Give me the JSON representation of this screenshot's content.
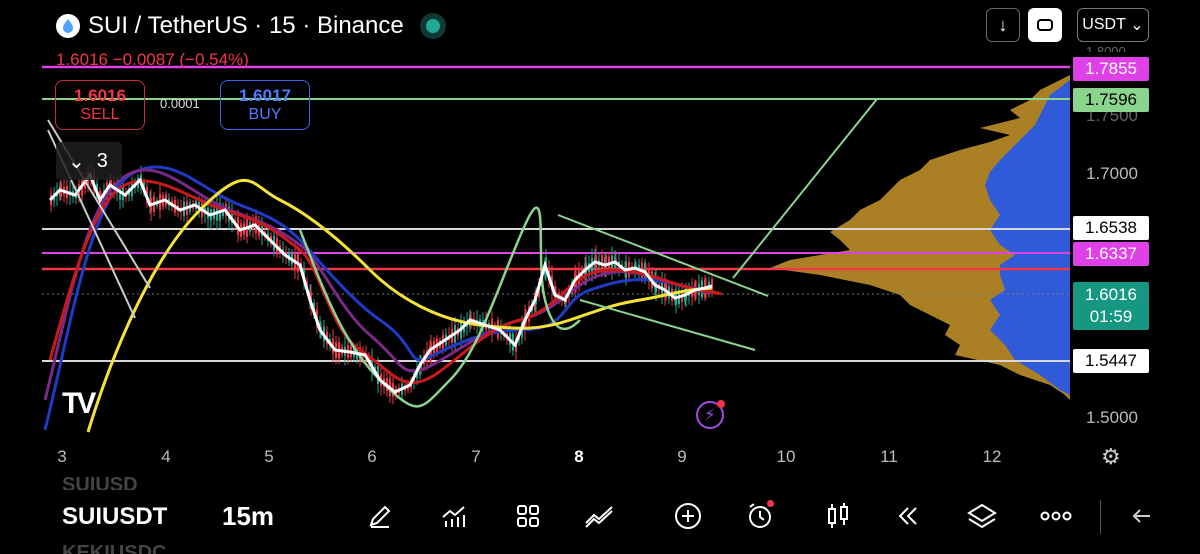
{
  "header": {
    "title": "SUI / TetherUS · 15 · Binance",
    "ohlc_text": "1.6016  −0.0087 (−0.54%)",
    "currency": "USDT"
  },
  "trade": {
    "sell_price": "1.6016",
    "sell_label": "SELL",
    "buy_price": "1.6017",
    "buy_label": "BUY",
    "spread": "0.0001"
  },
  "indicators_count": "3",
  "price_axis": {
    "ticks": [
      "1.7000",
      "1.5000"
    ],
    "partial_top_tick": "1.7500"
  },
  "price_tags": [
    {
      "value": "1.7855",
      "style": "pink"
    },
    {
      "value": "1.7596",
      "style": "green"
    },
    {
      "value": "1.6538",
      "style": "white"
    },
    {
      "value": "1.6337",
      "style": "pink"
    },
    {
      "value": "1.5447",
      "style": "white"
    }
  ],
  "last_price": {
    "value": "1.6016",
    "countdown": "01:59"
  },
  "time_axis": [
    "3",
    "4",
    "5",
    "6",
    "7",
    "8",
    "9",
    "10",
    "11",
    "12"
  ],
  "time_axis_highlight": "8",
  "bottom": {
    "symbol_above": "SUIUSD",
    "symbol": "SUIUSDT",
    "symbol_below": "KEKIUSDC",
    "timeframe": "15m",
    "icons": [
      "pen-icon",
      "indicators-icon",
      "grid-icon",
      "trend-icon",
      "plus-circle-icon",
      "alarm-icon",
      "candles-icon",
      "rewind-icon",
      "layers-icon",
      "more-icon",
      "back-icon"
    ]
  },
  "colors": {
    "bull": "#22ab94",
    "bear": "#f23645",
    "pink_line": "#e040e8",
    "green_line": "#8ad48e",
    "red_line": "#f23645",
    "yellow_ma": "#f5e236",
    "volume_profile_gold": "#c9962a",
    "volume_profile_blue": "#2f5bd8"
  }
}
